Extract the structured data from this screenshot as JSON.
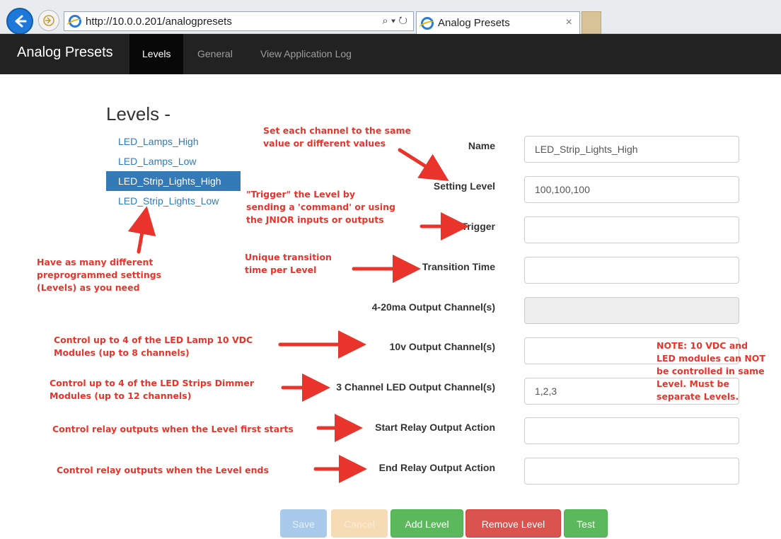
{
  "browser": {
    "url": "http://10.0.0.201/analogpresets",
    "search_tools": "⌕ ▾ ↻",
    "tab_title": "Analog Presets",
    "tab_close": "×"
  },
  "navbar": {
    "brand": "Analog Presets",
    "items": [
      "Levels",
      "General",
      "View Application Log"
    ],
    "active": "Levels"
  },
  "levels": {
    "heading": "Levels -",
    "items": [
      "LED_Lamps_High",
      "LED_Lamps_Low",
      "LED_Strip_Lights_High",
      "LED_Strip_Lights_Low"
    ],
    "selected": "LED_Strip_Lights_High"
  },
  "form": {
    "name_label": "Name",
    "name_value": "LED_Strip_Lights_High",
    "setting_level_label": "Setting Level",
    "setting_level_value": "100,100,100",
    "trigger_label": "Trigger",
    "trigger_value": "",
    "transition_time_label": "Transition Time",
    "transition_time_value": "",
    "output_4_20ma_label": "4-20ma Output Channel(s)",
    "output_4_20ma_value": "",
    "output_10v_label": "10v Output Channel(s)",
    "output_10v_value": "",
    "output_3ch_led_label": "3 Channel LED Output Channel(s)",
    "output_3ch_led_value": "1,2,3",
    "start_relay_label": "Start Relay Output Action",
    "start_relay_value": "",
    "end_relay_label": "End Relay Output Action",
    "end_relay_value": ""
  },
  "buttons": {
    "save": "Save",
    "cancel": "Cancel",
    "add_level": "Add Level",
    "remove_level": "Remove Level",
    "test": "Test"
  },
  "annotations": {
    "set_channel_1": "Set each channel to the same",
    "set_channel_2": "value or different values",
    "trigger_1": "\"Trigger\" the Level by",
    "trigger_2": "sending a 'command' or using",
    "trigger_3": "the JNIOR inputs or outputs",
    "transition_1": "Unique transition",
    "transition_2": "time per Level",
    "levels_1": "Have as many different",
    "levels_2": "preprogrammed settings",
    "levels_3": "(Levels) as you need",
    "lamp_1": "Control up to 4 of the LED Lamp 10 VDC",
    "lamp_2": "Modules (up to 8 channels)",
    "strip_1": "Control up to 4 of the LED Strips Dimmer",
    "strip_2": "Modules (up to 12 channels)",
    "relay_start": "Control relay outputs when the Level first starts",
    "relay_end": "Control relay outputs when the Level ends",
    "note_1": "NOTE: 10 VDC and",
    "note_2": "LED modules can NOT",
    "note_3": "be controlled in same",
    "note_4": "Level.  Must be",
    "note_5": "separate Levels."
  },
  "colors": {
    "navbar": "#222222",
    "link": "#337ab7",
    "annotation": "#e8342a",
    "success": "#5cb85c",
    "danger": "#d9534f"
  }
}
